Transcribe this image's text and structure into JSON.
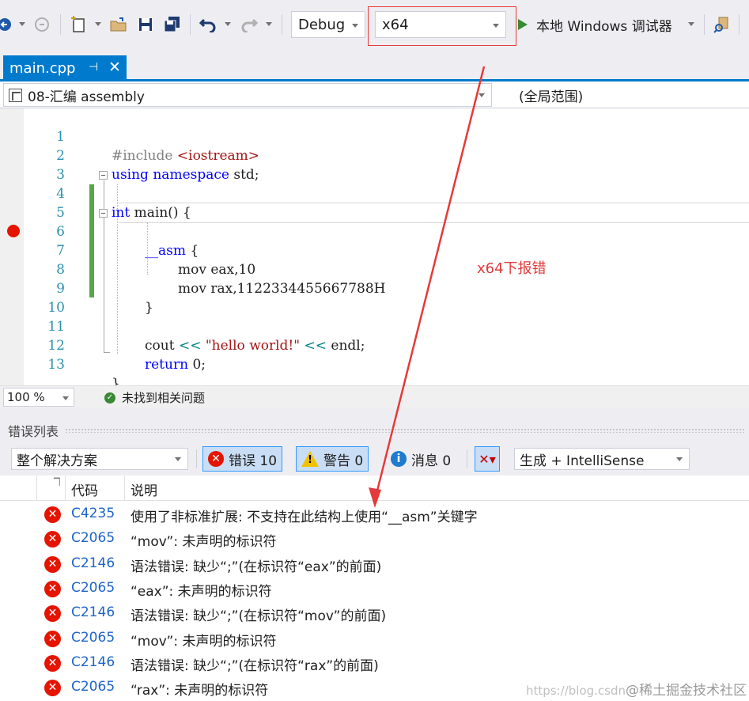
{
  "toolbar": {
    "configuration": "Debug",
    "platform": "x64",
    "run_label": "本地 Windows 调试器"
  },
  "tab": {
    "filename": "main.cpp",
    "pin_glyph": "⊣",
    "close_glyph": "✕"
  },
  "navbar": {
    "project": "08-汇编 assembly",
    "scope": "(全局范围)"
  },
  "editor": {
    "lines": [
      {
        "num": "1"
      },
      {
        "num": "2"
      },
      {
        "num": "3"
      },
      {
        "num": "4"
      },
      {
        "num": "5"
      },
      {
        "num": "6"
      },
      {
        "num": "7"
      },
      {
        "num": "8"
      },
      {
        "num": "9"
      },
      {
        "num": "10"
      },
      {
        "num": "11"
      },
      {
        "num": "12"
      },
      {
        "num": "13"
      }
    ],
    "tokens": {
      "include_directive": "#include",
      "include_header": "<iostream>",
      "using": "using",
      "namespace": "namespace",
      "std": " std;",
      "int": "int",
      "main_sig": " main() {",
      "asm": "__asm",
      "asm_open": " {",
      "mov1": "mov eax,10",
      "mov2": "mov rax,1122334455667788H",
      "close_brace": "}",
      "cout": "cout ",
      "shift1": "<<",
      "hello": " \"hello world!\" ",
      "shift2": "<<",
      "endl": " endl;",
      "return": "return",
      "ret_val": " 0;",
      "fn_close": "}"
    }
  },
  "status": {
    "zoom": "100 %",
    "message": "未找到相关问题"
  },
  "error_list": {
    "title": "错误列表",
    "scope": "整个解决方案",
    "errors_label": "错误 10",
    "warnings_label": "警告 0",
    "messages_label": "消息 0",
    "build_filter": "生成 + IntelliSense",
    "col_code": "代码",
    "col_desc": "说明",
    "rows": [
      {
        "code": "C4235",
        "desc": "使用了非标准扩展: 不支持在此结构上使用“__asm”关键字"
      },
      {
        "code": "C2065",
        "desc": "“mov”: 未声明的标识符"
      },
      {
        "code": "C2146",
        "desc": "语法错误: 缺少“;”(在标识符“eax”的前面)"
      },
      {
        "code": "C2065",
        "desc": "“eax”: 未声明的标识符"
      },
      {
        "code": "C2146",
        "desc": "语法错误: 缺少“;”(在标识符“mov”的前面)"
      },
      {
        "code": "C2065",
        "desc": "“mov”: 未声明的标识符"
      },
      {
        "code": "C2146",
        "desc": "语法错误: 缺少“;”(在标识符“rax”的前面)"
      },
      {
        "code": "C2065",
        "desc": "“rax”: 未声明的标识符"
      }
    ]
  },
  "annotation": {
    "text": "x64下报错"
  },
  "watermark": {
    "url": "https://blog.csdn",
    "site": "@稀土掘金技术社区"
  },
  "colors": {
    "accent": "#007acc",
    "error": "#e51400",
    "annotation": "#e03a3a",
    "link": "#1e64c8"
  }
}
